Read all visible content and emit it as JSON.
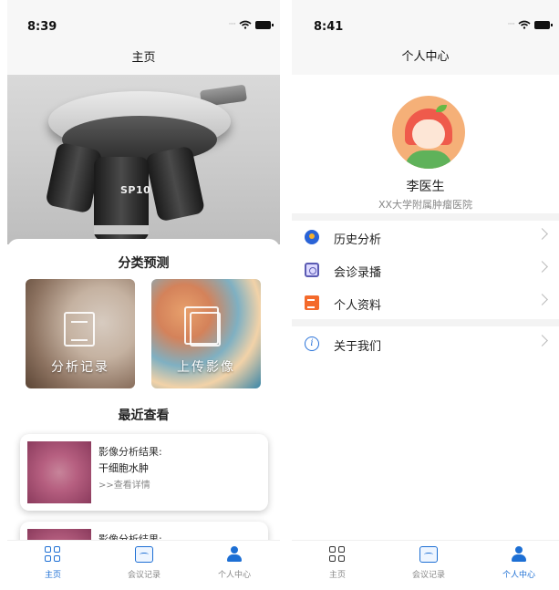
{
  "left": {
    "status": {
      "time": "8:39"
    },
    "nav_title": "主页",
    "hero": {
      "objective_text": "SP10"
    },
    "sections": {
      "classify_title": "分类预测",
      "tiles": [
        {
          "label": "分析记录",
          "icon": "document-list-icon"
        },
        {
          "label": "上传影像",
          "icon": "copy-image-icon"
        }
      ],
      "recent_title": "最近查看"
    },
    "recent_cards": [
      {
        "title": "影像分析结果:",
        "result": "干细胞水肿",
        "link": ">>查看详情"
      },
      {
        "title": "影像分析结果:",
        "result": "",
        "link": ""
      }
    ],
    "tabbar": [
      {
        "label": "主页",
        "icon": "grid-icon",
        "active": true
      },
      {
        "label": "会议记录",
        "icon": "meeting-icon",
        "active": false
      },
      {
        "label": "个人中心",
        "icon": "person-icon",
        "active": false
      }
    ]
  },
  "right": {
    "status": {
      "time": "8:41"
    },
    "nav_title": "个人中心",
    "profile": {
      "name": "李医生",
      "org": "XX大学附属肿瘤医院"
    },
    "menu": [
      {
        "label": "历史分析",
        "icon": "history-icon"
      },
      {
        "label": "会诊录播",
        "icon": "record-icon"
      },
      {
        "label": "个人资料",
        "icon": "profile-icon"
      },
      {
        "label": "关于我们",
        "icon": "info-icon"
      }
    ],
    "tabbar": [
      {
        "label": "主页",
        "icon": "grid-icon",
        "active": false
      },
      {
        "label": "会议记录",
        "icon": "meeting-icon",
        "active": false
      },
      {
        "label": "个人中心",
        "icon": "person-icon",
        "active": true
      }
    ]
  },
  "colors": {
    "accent": "#1d6fd4"
  }
}
